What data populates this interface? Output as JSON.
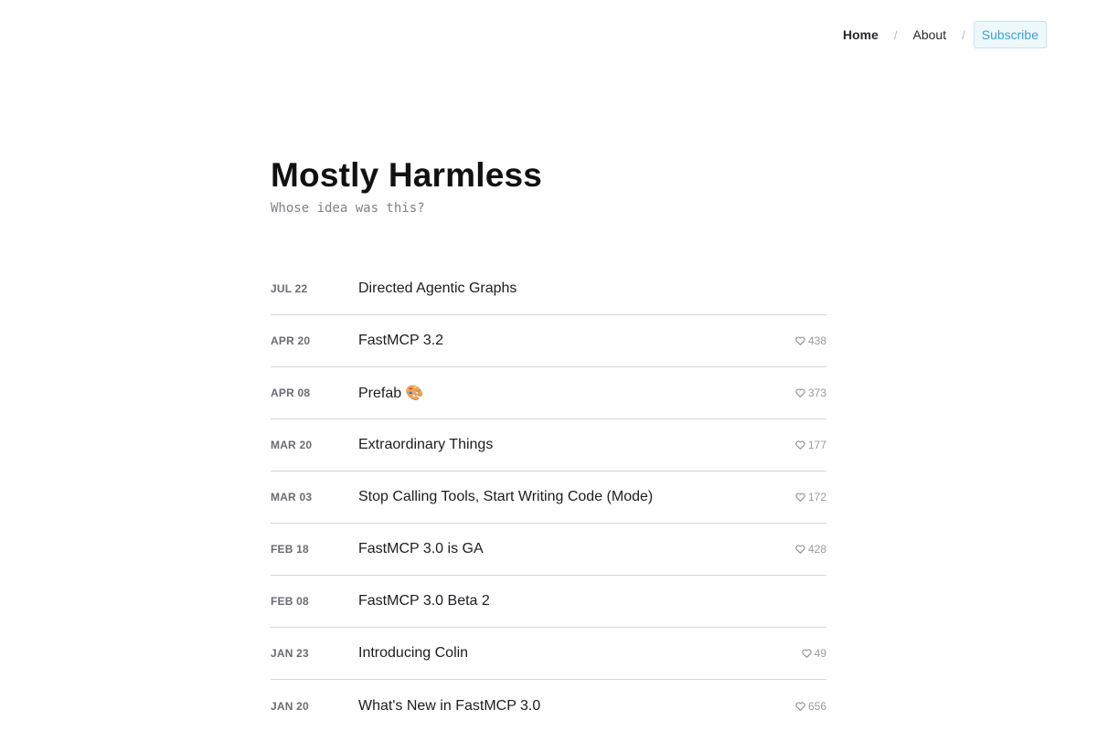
{
  "nav": {
    "home": "Home",
    "about": "About",
    "subscribe": "Subscribe",
    "separator": "/"
  },
  "header": {
    "title": "Mostly Harmless",
    "tagline": "Whose idea was this?"
  },
  "posts": [
    {
      "date": "JUL 22",
      "title": "Directed Agentic Graphs",
      "likes": null
    },
    {
      "date": "APR 20",
      "title": "FastMCP 3.2",
      "likes": "438"
    },
    {
      "date": "APR 08",
      "title": "Prefab 🎨",
      "likes": "373"
    },
    {
      "date": "MAR 20",
      "title": "Extraordinary Things",
      "likes": "177"
    },
    {
      "date": "MAR 03",
      "title": "Stop Calling Tools, Start Writing Code (Mode)",
      "likes": "172"
    },
    {
      "date": "FEB 18",
      "title": "FastMCP 3.0 is GA",
      "likes": "428"
    },
    {
      "date": "FEB 08",
      "title": "FastMCP 3.0 Beta 2",
      "likes": null
    },
    {
      "date": "JAN 23",
      "title": "Introducing Colin",
      "likes": "49"
    },
    {
      "date": "JAN 20",
      "title": "What's New in FastMCP 3.0",
      "likes": "656"
    }
  ],
  "icons": {
    "like": "heart-icon"
  },
  "colors": {
    "accent": "#3ba3c8",
    "divider": "#d6d6db"
  }
}
